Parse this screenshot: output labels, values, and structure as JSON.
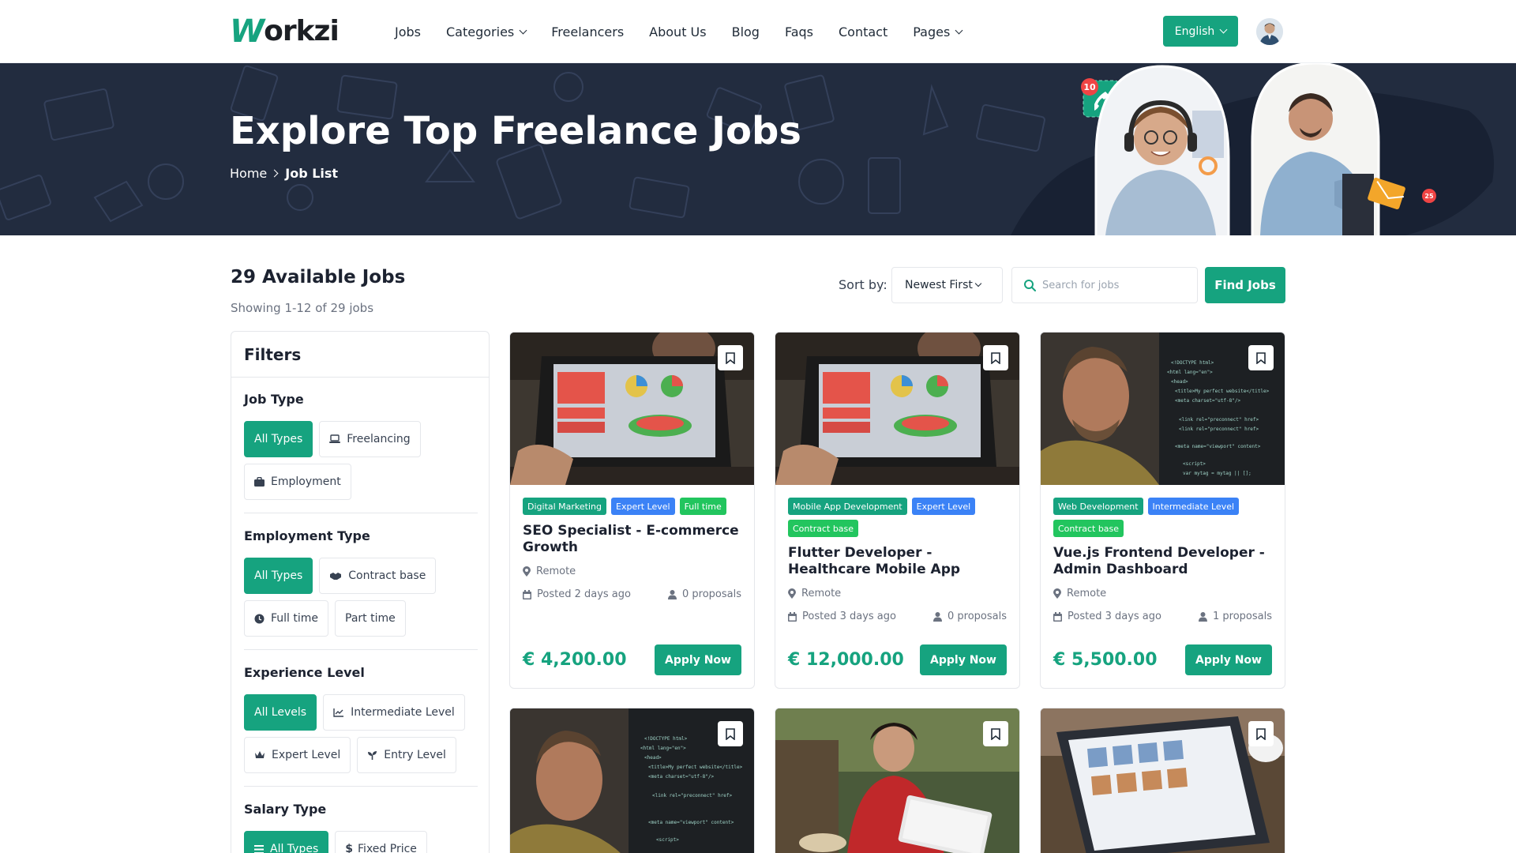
{
  "brand": {
    "logo_mark": "W",
    "logo_text": "orkzi"
  },
  "nav": {
    "jobs": "Jobs",
    "categories": "Categories",
    "freelancers": "Freelancers",
    "about": "About Us",
    "blog": "Blog",
    "faqs": "Faqs",
    "contact": "Contact",
    "pages": "Pages"
  },
  "language": "English",
  "banner": {
    "title": "Explore Top Freelance Jobs",
    "breadcrumb": [
      "Home",
      "Job List"
    ],
    "notification_count": "10",
    "mail_badge": "25"
  },
  "results": {
    "title": "29 Available Jobs",
    "showing": "Showing 1-12 of 29 jobs",
    "sort_label": "Sort by:",
    "sort_value": "Newest First",
    "search_placeholder": "Search for jobs",
    "find_button": "Find Jobs"
  },
  "filters": {
    "title": "Filters",
    "groups": [
      {
        "title": "Job Type",
        "options": [
          "All Types",
          "Freelancing",
          "Employment"
        ]
      },
      {
        "title": "Employment Type",
        "options": [
          "All Types",
          "Contract base",
          "Full time",
          "Part time"
        ]
      },
      {
        "title": "Experience Level",
        "options": [
          "All Levels",
          "Intermediate Level",
          "Expert Level",
          "Entry Level"
        ]
      },
      {
        "title": "Salary Type",
        "options": [
          "All Types",
          "Fixed Price"
        ]
      }
    ]
  },
  "jobs": [
    {
      "tags": [
        "Digital Marketing",
        "Expert Level",
        "Full time"
      ],
      "title": "SEO Specialist - E-commerce Growth",
      "location": "Remote",
      "posted": "Posted 2 days ago",
      "proposals": "0 proposals",
      "price": "€ 4,200.00",
      "apply": "Apply Now"
    },
    {
      "tags": [
        "Mobile App Development",
        "Expert Level",
        "Contract base"
      ],
      "title": "Flutter Developer - Healthcare Mobile App",
      "location": "Remote",
      "posted": "Posted 3 days ago",
      "proposals": "0 proposals",
      "price": "€ 12,000.00",
      "apply": "Apply Now"
    },
    {
      "tags": [
        "Web Development",
        "Intermediate Level",
        "Contract base"
      ],
      "title": "Vue.js Frontend Developer - Admin Dashboard",
      "location": "Remote",
      "posted": "Posted 3 days ago",
      "proposals": "1 proposals",
      "price": "€ 5,500.00",
      "apply": "Apply Now"
    }
  ],
  "colors": {
    "accent": "#16a37f",
    "banner": "#222c3f",
    "tag_blue": "#3b82f6",
    "tag_lime": "#22c55e"
  },
  "icons": [
    "chevron-down-icon",
    "chevron-right-icon",
    "search-icon",
    "bookmark-icon",
    "location-pin-icon",
    "calendar-icon",
    "user-icon",
    "phone-icon",
    "mail-icon"
  ]
}
